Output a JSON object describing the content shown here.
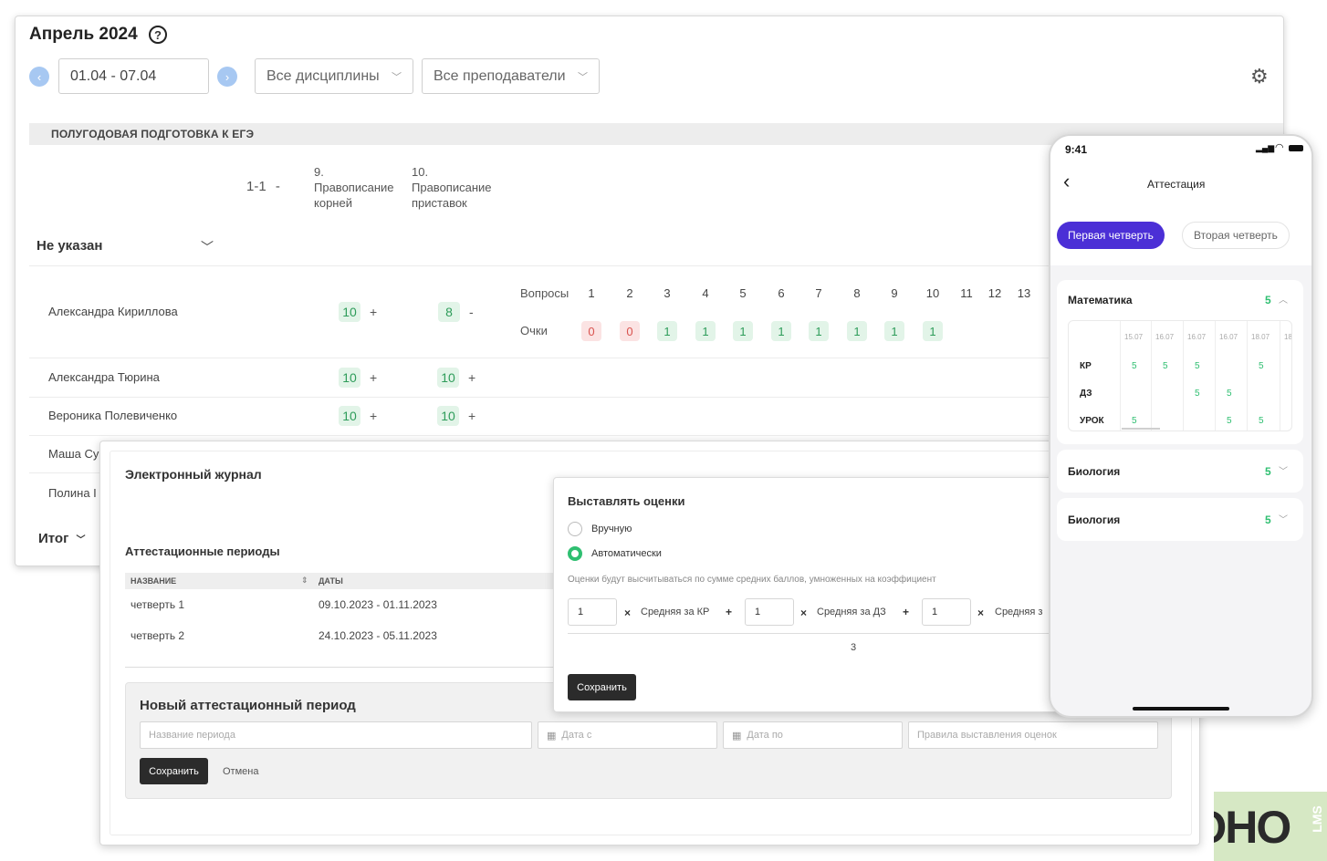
{
  "journal": {
    "title": "Апрель 2024",
    "help_glyph": "?",
    "date_range": "01.04 - 07.04",
    "prev_glyph": "‹",
    "next_glyph": "›",
    "disciplines_filter": "Все дисциплины",
    "teachers_filter": "Все преподаватели",
    "course_title": "ПОЛУГОДОВАЯ ПОДГОТОВКА К ЕГЭ",
    "columns": [
      {
        "num": "1-1",
        "suffix": "-"
      },
      {
        "num": "9.",
        "line1": "Правописание",
        "line2": "корней"
      },
      {
        "num": "10.",
        "line1": "Правописание",
        "line2": "приставок"
      }
    ],
    "group_label": "Не указан",
    "students": [
      {
        "name": "Александра Кириллова",
        "score1": "10",
        "sign1": "+",
        "score2": "8",
        "sign2": "-"
      },
      {
        "name": "Александра Тюрина",
        "score1": "10",
        "sign1": "+",
        "score2": "10",
        "sign2": "+"
      },
      {
        "name": "Вероника Полевиченко",
        "score1": "10",
        "sign1": "+",
        "score2": "10",
        "sign2": "+"
      },
      {
        "name": "Маша Су"
      },
      {
        "name": "Полина I"
      }
    ],
    "total_label": "Итог",
    "questions_label": "Вопросы",
    "points_label": "Очки",
    "questions": [
      "1",
      "2",
      "3",
      "4",
      "5",
      "6",
      "7",
      "8",
      "9",
      "10",
      "11",
      "12",
      "13"
    ],
    "points": [
      "0",
      "0",
      "1",
      "1",
      "1",
      "1",
      "1",
      "1",
      "1",
      "1"
    ],
    "colors": {
      "accent_green": "#2e9c5a",
      "accent_red": "#d9534f",
      "nav_blue": "#a7c8f2"
    }
  },
  "attestation": {
    "title": "Электронный журнал",
    "periods_title": "Аттестационные периоды",
    "col_name": "НАЗВАНИЕ",
    "col_dates": "ДАТЫ",
    "rows": [
      {
        "name": "четверть 1",
        "dates": "09.10.2023 - 01.11.2023"
      },
      {
        "name": "четверть 2",
        "dates": "24.10.2023 - 05.11.2023"
      }
    ],
    "new_period_title": "Новый аттестационный период",
    "name_placeholder": "Название периода",
    "date_from_placeholder": "Дата с",
    "date_to_placeholder": "Дата по",
    "rules_placeholder": "Правила выставления оценок",
    "save_label": "Сохранить",
    "cancel_label": "Отмена"
  },
  "grades_popup": {
    "title": "Выставлять оценки",
    "manual_label": "Вручную",
    "auto_label": "Автоматически",
    "selected": "Автоматически",
    "hint": "Оценки будут высчитываться по сумме средних баллов, умноженных на коэффициент",
    "coef1": "1",
    "coef2": "1",
    "coef3": "1",
    "times": "×",
    "plus": "+",
    "term1": "Средняя за КР",
    "term2": "Средняя за ДЗ",
    "term3": "Средняя з",
    "result": "3",
    "save_label": "Сохранить"
  },
  "phone": {
    "time": "9:41",
    "back_glyph": "‹",
    "title": "Аттестация",
    "tab_active": "Первая четверть",
    "tab_inactive": "Вторая четверть",
    "subjects": [
      {
        "name": "Математика",
        "grade": "5",
        "expanded": true
      },
      {
        "name": "Биология",
        "grade": "5",
        "expanded": false
      },
      {
        "name": "Биология",
        "grade": "5",
        "expanded": false
      }
    ],
    "dates": [
      "15.07",
      "16.07",
      "16.07",
      "16.07",
      "18.07",
      "18"
    ],
    "grid_rows": [
      {
        "label": "КР",
        "cells": [
          "5",
          "5",
          "5",
          "",
          "5"
        ]
      },
      {
        "label": "ДЗ",
        "cells": [
          "",
          "",
          "5",
          "5",
          ""
        ]
      },
      {
        "label": "УРОК",
        "cells": [
          "5",
          "",
          "",
          "5",
          "5"
        ]
      }
    ],
    "chevron_up": "︿",
    "chevron_down": "﹀",
    "colors": {
      "active_tab": "#4b2fd6",
      "grade": "#2fbf71"
    }
  },
  "watermark": {
    "text": "SOHO",
    "side": "LMS"
  }
}
